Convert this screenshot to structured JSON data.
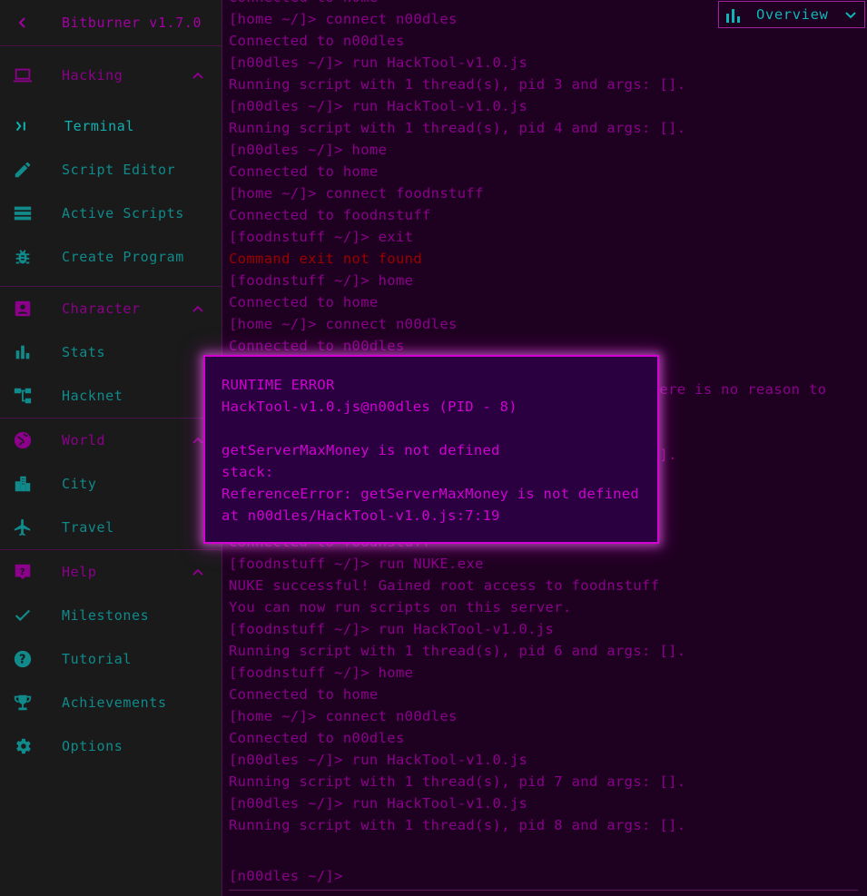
{
  "app": {
    "title": "Bitburner v1.7.0"
  },
  "sidebar": {
    "sections": [
      {
        "label": "Hacking",
        "icon": "laptop-icon"
      },
      {
        "label": "Character",
        "icon": "account-box-icon"
      },
      {
        "label": "World",
        "icon": "globe-icon"
      },
      {
        "label": "Help",
        "icon": "live-help-icon"
      }
    ],
    "items": [
      {
        "label": "Terminal",
        "icon": "terminal-icon"
      },
      {
        "label": "Script Editor",
        "icon": "pencil-icon"
      },
      {
        "label": "Active Scripts",
        "icon": "storage-icon"
      },
      {
        "label": "Create Program",
        "icon": "bug-icon"
      },
      {
        "label": "Stats",
        "icon": "bar-chart-icon"
      },
      {
        "label": "Hacknet",
        "icon": "account-tree-icon"
      },
      {
        "label": "City",
        "icon": "city-icon"
      },
      {
        "label": "Travel",
        "icon": "airplane-icon"
      },
      {
        "label": "Milestones",
        "icon": "check-icon"
      },
      {
        "label": "Tutorial",
        "icon": "help-icon"
      },
      {
        "label": "Achievements",
        "icon": "trophy-icon"
      },
      {
        "label": "Options",
        "icon": "gear-icon"
      }
    ]
  },
  "overview": {
    "label": "Overview"
  },
  "terminal": {
    "lines": [
      {
        "text": "Connected to home",
        "kind": "out"
      },
      {
        "text": "[home ~/]> connect n00dles",
        "kind": "cmd"
      },
      {
        "text": "Connected to n00dles",
        "kind": "out"
      },
      {
        "text": "[n00dles ~/]> run HackTool-v1.0.js",
        "kind": "cmd"
      },
      {
        "text": "Running script with 1 thread(s), pid 3 and args: [].",
        "kind": "out"
      },
      {
        "text": "[n00dles ~/]> run HackTool-v1.0.js",
        "kind": "cmd"
      },
      {
        "text": "Running script with 1 thread(s), pid 4 and args: [].",
        "kind": "out"
      },
      {
        "text": "[n00dles ~/]> home",
        "kind": "cmd"
      },
      {
        "text": "Connected to home",
        "kind": "out"
      },
      {
        "text": "[home ~/]> connect foodnstuff",
        "kind": "cmd"
      },
      {
        "text": "Connected to foodnstuff",
        "kind": "out"
      },
      {
        "text": "[foodnstuff ~/]> exit",
        "kind": "cmd"
      },
      {
        "text": "Command exit not found",
        "kind": "err"
      },
      {
        "text": "[foodnstuff ~/]> home",
        "kind": "cmd"
      },
      {
        "text": "Connected to home",
        "kind": "out"
      },
      {
        "text": "[home ~/]> connect n00dles",
        "kind": "cmd"
      },
      {
        "text": "Connected to n00dles",
        "kind": "out"
      },
      {
        "text": "",
        "kind": "out"
      },
      {
        "text": "                                                 ere is no reason to",
        "kind": "out"
      },
      {
        "text": "",
        "kind": "out"
      },
      {
        "text": "",
        "kind": "out"
      },
      {
        "text": "                                                 ].",
        "kind": "out"
      },
      {
        "text": "",
        "kind": "out"
      },
      {
        "text": "",
        "kind": "out"
      },
      {
        "text": "[home ~/]> connect foodnstuff",
        "kind": "cmd"
      },
      {
        "text": "Connected to foodnstuff",
        "kind": "out"
      },
      {
        "text": "[foodnstuff ~/]> run NUKE.exe",
        "kind": "cmd"
      },
      {
        "text": "NUKE successful! Gained root access to foodnstuff",
        "kind": "out"
      },
      {
        "text": "You can now run scripts on this server.",
        "kind": "out"
      },
      {
        "text": "[foodnstuff ~/]> run HackTool-v1.0.js",
        "kind": "cmd"
      },
      {
        "text": "Running script with 1 thread(s), pid 6 and args: [].",
        "kind": "out"
      },
      {
        "text": "[foodnstuff ~/]> home",
        "kind": "cmd"
      },
      {
        "text": "Connected to home",
        "kind": "out"
      },
      {
        "text": "[home ~/]> connect n00dles",
        "kind": "cmd"
      },
      {
        "text": "Connected to n00dles",
        "kind": "out"
      },
      {
        "text": "[n00dles ~/]> run HackTool-v1.0.js",
        "kind": "cmd"
      },
      {
        "text": "Running script with 1 thread(s), pid 7 and args: [].",
        "kind": "out"
      },
      {
        "text": "[n00dles ~/]> run HackTool-v1.0.js",
        "kind": "cmd"
      },
      {
        "text": "Running script with 1 thread(s), pid 8 and args: [].",
        "kind": "out"
      }
    ],
    "prompt": "[n00dles ~/]>"
  },
  "dialog": {
    "lines": [
      "RUNTIME ERROR",
      "HackTool-v1.0.js@n00dles (PID - 8)",
      "",
      "getServerMaxMoney is not defined",
      "stack:",
      "ReferenceError: getServerMaxMoney is not defined",
      "at n00dles/HackTool-v1.0.js:7:19"
    ]
  }
}
